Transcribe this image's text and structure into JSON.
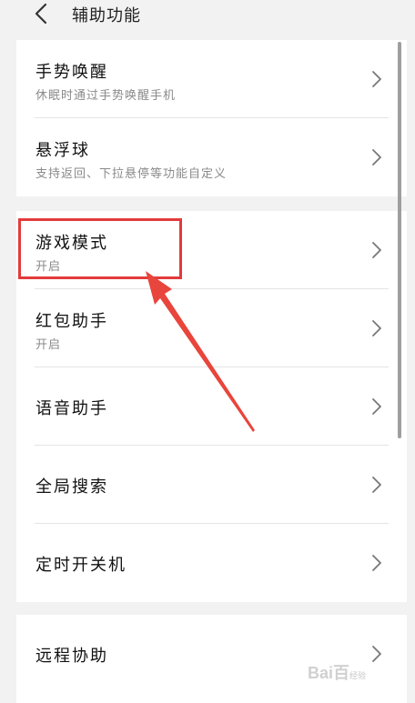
{
  "header": {
    "title": "辅助功能",
    "back_icon": "chevron-left-icon"
  },
  "group1": [
    {
      "label": "手势唤醒",
      "sub": "休眠时通过手势唤醒手机"
    },
    {
      "label": "悬浮球",
      "sub": "支持返回、下拉悬停等功能自定义"
    }
  ],
  "group2": [
    {
      "label": "游戏模式",
      "sub": "开启"
    },
    {
      "label": "红包助手",
      "sub": "开启"
    },
    {
      "label": "语音助手"
    },
    {
      "label": "全局搜索"
    },
    {
      "label": "定时开关机"
    }
  ],
  "group3": [
    {
      "label": "远程协助"
    }
  ],
  "annotation": {
    "highlight_color": "#e23b3b",
    "target": "游戏模式"
  },
  "watermark": {
    "text": "Bai百",
    "sub": "经验"
  },
  "icons": {
    "row_chevron": "chevron-right-icon"
  }
}
